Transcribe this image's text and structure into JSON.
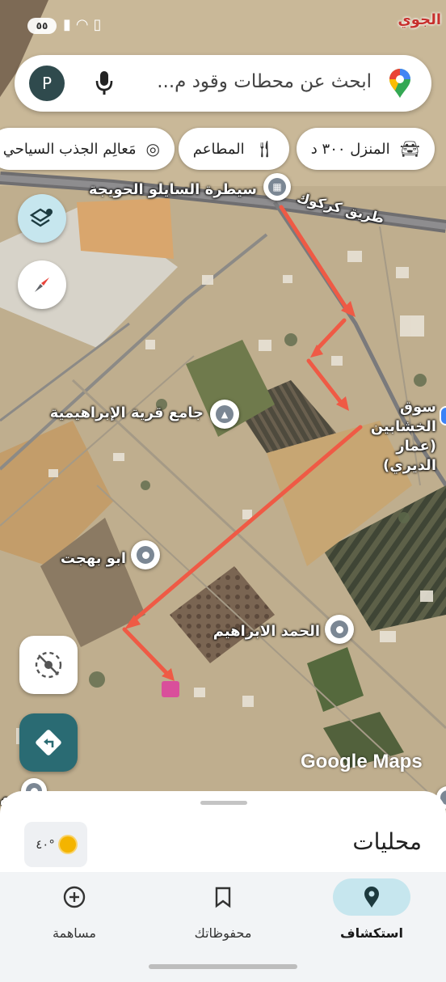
{
  "status_bar": {
    "battery": "٥٥"
  },
  "search": {
    "placeholder": "ابحث عن محطات وقود م...",
    "avatar_letter": "P"
  },
  "chips": [
    {
      "label": "المنزل ٣٠٠ د",
      "icon": "car-icon"
    },
    {
      "label": "المطاعم",
      "icon": "restaurant-icon"
    },
    {
      "label": "مَعالِم الجذب السياحي",
      "icon": "camera-icon"
    }
  ],
  "map": {
    "top_right_label": "الجوي",
    "labels": {
      "checkpoint": "سيطرة السايلو الحويجة",
      "road": "طريق كركوك",
      "mosque": "جامع قرية الإبراهيمية",
      "market": "سوق الخشابين (عمار الديري)",
      "abu_bahjat": "ابو بهجت",
      "hamad": "الحمد الابراهيم",
      "left_edge": "عم"
    },
    "logo": "Google Maps"
  },
  "sheet": {
    "title": "محليات",
    "weather": "٤٠°"
  },
  "nav": [
    {
      "label": "استكشاف",
      "icon": "explore-pin-icon",
      "active": true
    },
    {
      "label": "محفوظاتك",
      "icon": "bookmark-icon",
      "active": false
    },
    {
      "label": "مساهمة",
      "icon": "add-circle-icon",
      "active": false
    }
  ],
  "colors": {
    "accent": "#2a6b73",
    "route_arrow": "#ef5a45",
    "active_nav": "#c6e6ee"
  }
}
